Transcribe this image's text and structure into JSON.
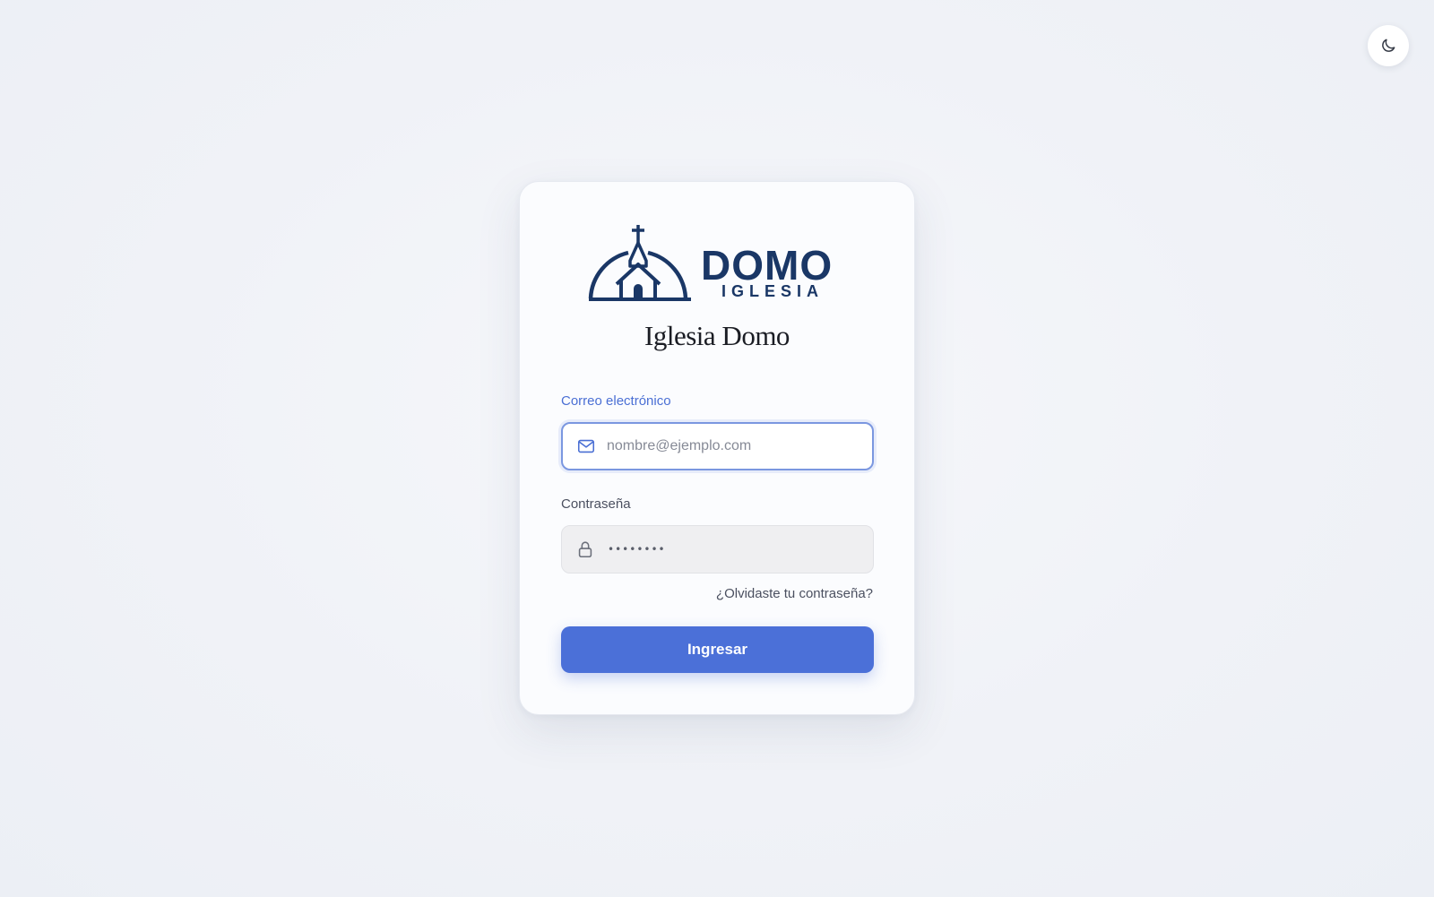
{
  "theme_toggle": {
    "icon": "moon-icon"
  },
  "logo": {
    "main_text": "DOMO",
    "sub_text": "IGLESIA",
    "color": "#1a3766"
  },
  "church_title": "Iglesia Domo",
  "form": {
    "email": {
      "label": "Correo electrónico",
      "placeholder": "nombre@ejemplo.com",
      "value": "",
      "icon": "mail-icon"
    },
    "password": {
      "label": "Contraseña",
      "masked_value": "••••••••",
      "icon": "lock-icon"
    },
    "forgot_link": "¿Olvidaste tu contraseña?",
    "submit_label": "Ingresar"
  },
  "colors": {
    "accent": "#4b70d8",
    "focus_border": "#7b97e0",
    "brand_navy": "#1a3766"
  }
}
